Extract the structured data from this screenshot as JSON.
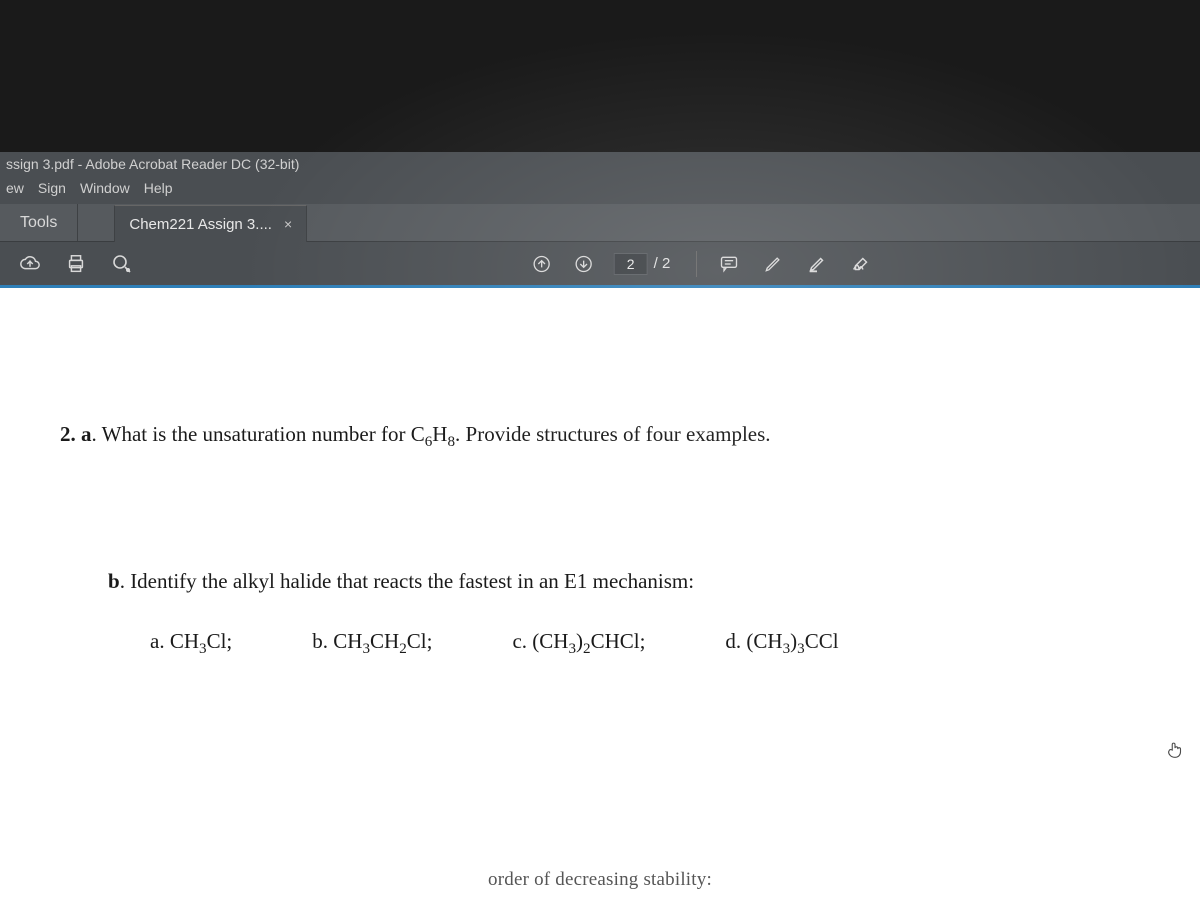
{
  "titlebar": "ssign 3.pdf - Adobe Acrobat Reader DC (32-bit)",
  "menubar": {
    "items": [
      "ew",
      "Sign",
      "Window",
      "Help"
    ]
  },
  "tabs": {
    "tools": "Tools",
    "active": "Chem221 Assign 3....",
    "close": "×"
  },
  "pagebox": {
    "current": "2",
    "total": "/ 2"
  },
  "doc": {
    "q2a_num": "2. a",
    "q2a_text": ". What is the unsaturation number for C",
    "q2a_sub1": "6",
    "q2a_mid": "H",
    "q2a_sub2": "8",
    "q2a_tail": ".  Provide structures of four examples.",
    "q2b_label": "b",
    "q2b_text": ". Identify the alkyl halide that reacts the fastest in an E1 mechanism:",
    "options": {
      "a": {
        "label": "a. CH",
        "s1": "3",
        "tail": "Cl;"
      },
      "b": {
        "label": "b. CH",
        "s1": "3",
        "mid": "CH",
        "s2": "2",
        "tail": "Cl;"
      },
      "c": {
        "label": "c. (CH",
        "s1": "3",
        "mid": ")",
        "s2": "2",
        "mid2": "CHCl;",
        "tail": ""
      },
      "d": {
        "label": "d. (CH",
        "s1": "3",
        "mid": ")",
        "s2": "3",
        "mid2": "CCl",
        "tail": ""
      }
    },
    "cutoff": "order of decreasing stability:"
  }
}
